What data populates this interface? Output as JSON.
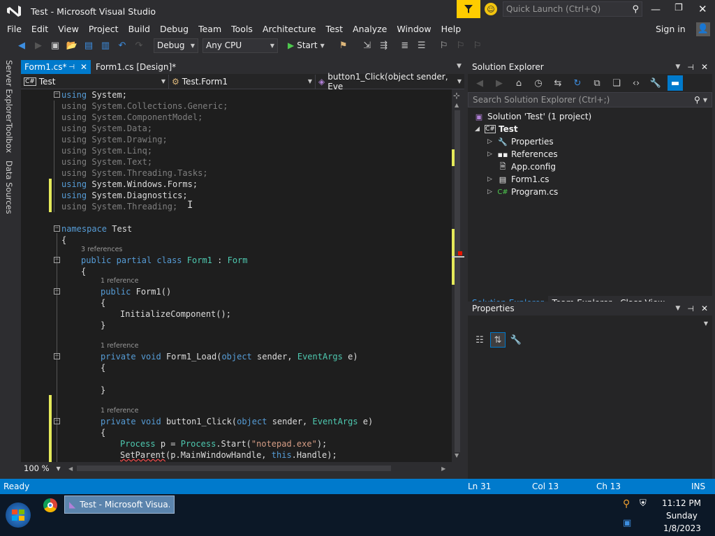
{
  "window": {
    "title": "Test - Microsoft Visual Studio",
    "quick_launch_placeholder": "Quick Launch (Ctrl+Q)"
  },
  "menu": [
    "File",
    "Edit",
    "View",
    "Project",
    "Build",
    "Debug",
    "Team",
    "Tools",
    "Architecture",
    "Test",
    "Analyze",
    "Window",
    "Help"
  ],
  "sign_in": "Sign in",
  "toolbar": {
    "config": "Debug",
    "platform": "Any CPU",
    "start": "Start"
  },
  "side_tabs": [
    "Server Explorer",
    "Toolbox",
    "Data Sources"
  ],
  "doc_tabs": [
    {
      "label": "Form1.cs*",
      "active": true
    },
    {
      "label": "Form1.cs [Design]*",
      "active": false
    }
  ],
  "nav": {
    "project": "Test",
    "class": "Test.Form1",
    "member": "button1_Click(object sender, Eve"
  },
  "code": {
    "usings": [
      "System",
      "System.Collections.Generic",
      "System.ComponentModel",
      "System.Data",
      "System.Drawing",
      "System.Linq",
      "System.Text",
      "System.Threading.Tasks",
      "System.Windows.Forms",
      "System.Diagnostics",
      "System.Threading"
    ],
    "kw_using": "using",
    "semicolon": ";",
    "kw_namespace": "namespace",
    "ns_name": "Test",
    "brace_open": "{",
    "brace_close": "}",
    "lens_3refs": "3 references",
    "lens_1ref": "1 reference",
    "kw_public": "public",
    "kw_partial": "partial",
    "kw_class": "class",
    "class_name": "Form1",
    "colon": ":",
    "base_type": "Form",
    "ctor": "Form1()",
    "init_call": "InitializeComponent();",
    "kw_private": "private",
    "kw_void": "void",
    "load_name": "Form1_Load(",
    "kw_object": "object",
    "sender": "sender,",
    "eventargs": "EventArgs",
    "e_close": "e)",
    "click_name": "button1_Click(",
    "process_type": "Process",
    "process_var": "p =",
    "process_start": "Start(",
    "notepad": "\"notepad.exe\"",
    "close_semi": ");",
    "setparent": "SetParent",
    "setparent_args": "(p.MainWindowHandle,",
    "kw_this": "this",
    ".Handle);": ".Handle);"
  },
  "zoom": "100 %",
  "solution_explorer": {
    "title": "Solution Explorer",
    "search_placeholder": "Search Solution Explorer (Ctrl+;)",
    "items": [
      {
        "label": "Solution 'Test' (1 project)",
        "icon": "solution-icon"
      },
      {
        "label": "Test",
        "icon": "csharp-project-icon"
      },
      {
        "label": "Properties",
        "icon": "wrench-icon"
      },
      {
        "label": "References",
        "icon": "references-icon"
      },
      {
        "label": "App.config",
        "icon": "config-file-icon"
      },
      {
        "label": "Form1.cs",
        "icon": "form-icon"
      },
      {
        "label": "Program.cs",
        "icon": "csharp-file-icon"
      }
    ],
    "bottom_tabs": [
      "Solution Explorer",
      "Team Explorer",
      "Class View"
    ]
  },
  "properties": {
    "title": "Properties"
  },
  "status": {
    "ready": "Ready",
    "ln": "Ln 31",
    "col": "Col 13",
    "ch": "Ch 13",
    "ins": "INS"
  },
  "taskbar": {
    "vs_task": "Test - Microsoft Visua...",
    "time": "11:12 PM",
    "day": "Sunday",
    "date": "1/8/2023"
  },
  "colors": {
    "accent": "#007acc",
    "keyword": "#569cd6",
    "type": "#4ec9b0",
    "string": "#d69d85",
    "changed_margin": "#e5ea5a",
    "vs_purple": "#68217a"
  }
}
